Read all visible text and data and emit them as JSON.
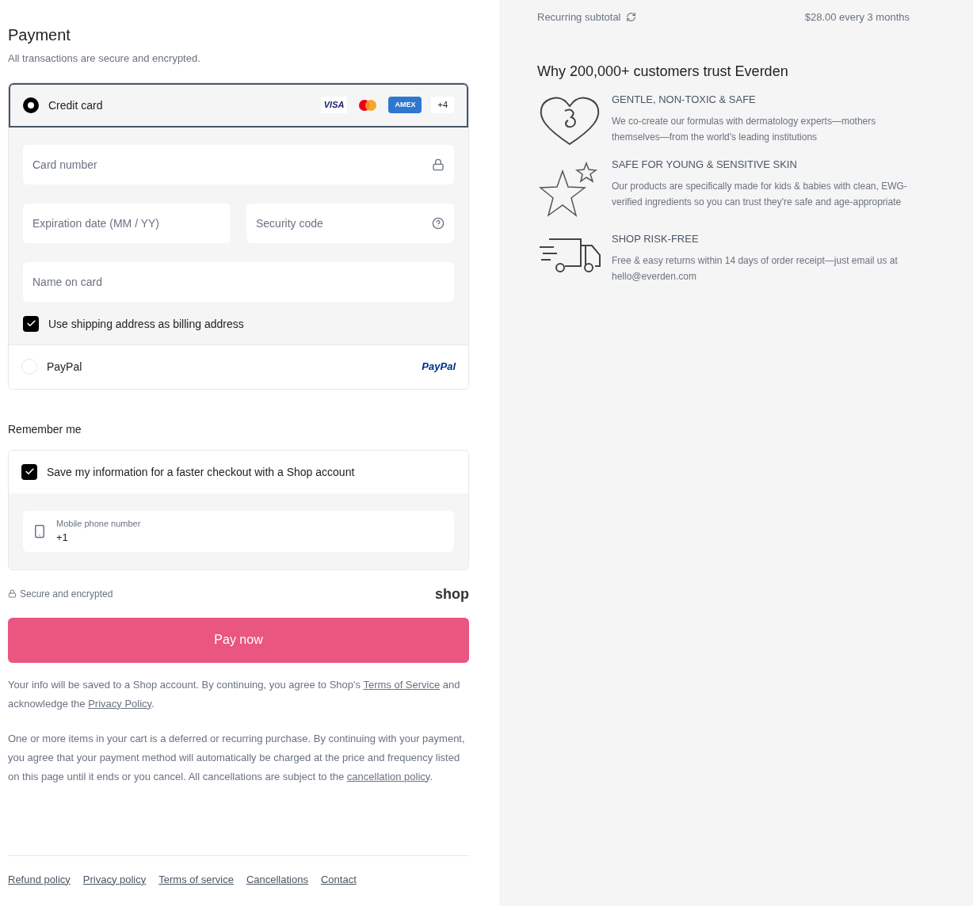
{
  "payment": {
    "title": "Payment",
    "subtitle": "All transactions are secure and encrypted.",
    "methods": [
      {
        "kind": "card",
        "label": "Credit card",
        "selected": true,
        "brands": [
          {
            "kind": "visa",
            "label": "VISA"
          },
          {
            "kind": "mastercard"
          },
          {
            "kind": "amex",
            "label": "AMEX"
          }
        ],
        "more": "+4",
        "fields": [
          {
            "placeholder": "Card number"
          },
          {
            "placeholder": "Expiration date (MM / YY)"
          },
          {
            "placeholder": "Security code"
          },
          {
            "placeholder": "Name on card"
          }
        ],
        "billing_checkbox": {
          "label": "Use shipping address as billing address",
          "checked": true
        }
      },
      {
        "kind": "paypal",
        "label": "PayPal",
        "selected": false,
        "logo": "PayPal"
      }
    ]
  },
  "remember": {
    "title": "Remember me",
    "checkbox": {
      "label": "Save my information for a faster checkout with a Shop account",
      "checked": true
    },
    "phone": {
      "label": "Mobile phone number",
      "value": "+1"
    }
  },
  "secure_note": "Secure and encrypted",
  "shop_logo": "shop",
  "pay_button": "Pay now",
  "notices": [
    [
      {
        "kind": "text",
        "text": "Your info will be saved to a Shop account. By continuing, you agree to Shop's "
      },
      {
        "kind": "link",
        "text": "Terms of Service"
      },
      {
        "kind": "text",
        "text": " and acknowledge the "
      },
      {
        "kind": "link",
        "text": "Privacy Policy"
      },
      {
        "kind": "text",
        "text": "."
      }
    ],
    [
      {
        "kind": "text",
        "text": "One or more items in your cart is a deferred or recurring purchase. By continuing with your payment, you agree that your payment method will automatically be charged at the price and frequency listed on this page until it ends or you cancel. All cancellations are subject to the "
      },
      {
        "kind": "link",
        "text": "cancellation policy"
      },
      {
        "kind": "text",
        "text": "."
      }
    ]
  ],
  "footer_links": [
    "Refund policy",
    "Privacy policy",
    "Terms of service",
    "Cancellations",
    "Contact"
  ],
  "summary": {
    "recurring_label": "Recurring subtotal",
    "recurring_value": "$28.00 every 3 months",
    "trust_title": "Why 200,000+ customers trust Everden",
    "features": [
      {
        "title": "GENTLE, NON-TOXIC & SAFE",
        "text": "We co-create our formulas with dermatology experts—mothers themselves—from the world's leading institutions"
      },
      {
        "title": "SAFE FOR YOUNG & SENSITIVE SKIN",
        "text": "Our products are specifically made for kids & babies with clean, EWG-verified ingredients so you can trust they're safe and age-appropriate"
      },
      {
        "title": "SHOP RISK-FREE",
        "text": "Free & easy returns within 14 days of order receipt—just email us at hello@everden.com"
      }
    ]
  }
}
